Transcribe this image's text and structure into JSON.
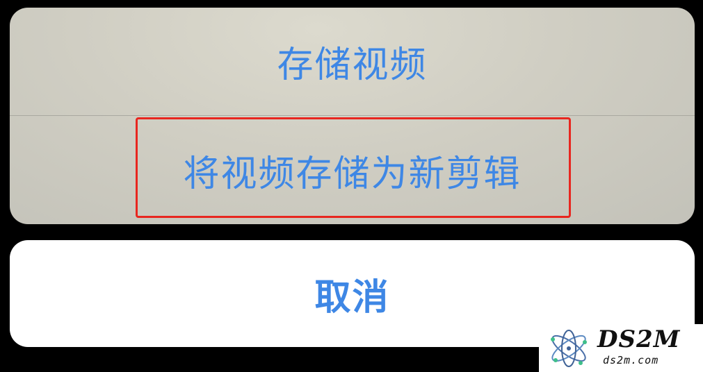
{
  "action_sheet": {
    "options": [
      {
        "label": "存储视频"
      },
      {
        "label": "将视频存储为新剪辑"
      }
    ],
    "cancel_label": "取消"
  },
  "annotation": {
    "highlight_color": "#e8261f"
  },
  "watermark": {
    "name": "DS2M",
    "url": "ds2m.com"
  },
  "colors": {
    "accent": "#3e87e5",
    "background": "#000000"
  }
}
